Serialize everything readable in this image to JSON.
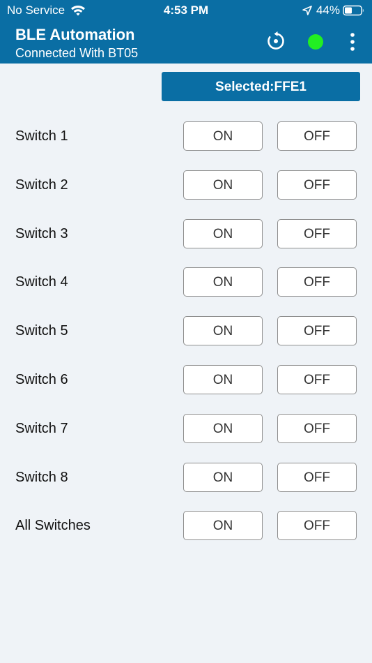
{
  "status_bar": {
    "carrier": "No Service",
    "time": "4:53 PM",
    "battery": "44%"
  },
  "app_bar": {
    "title": "BLE Automation",
    "subtitle": "Connected With BT05",
    "connection_color": "#22ee22",
    "icons": [
      "refresh-icon",
      "connection-status-dot",
      "more-vertical-icon"
    ]
  },
  "selected": {
    "label": "Selected:FFE1"
  },
  "colors": {
    "primary": "#0a6ea4",
    "background": "#eff3f7",
    "connected": "#22ee22"
  },
  "switches": [
    {
      "label": "Switch 1",
      "on": "ON",
      "off": "OFF"
    },
    {
      "label": "Switch 2",
      "on": "ON",
      "off": "OFF"
    },
    {
      "label": "Switch 3",
      "on": "ON",
      "off": "OFF"
    },
    {
      "label": "Switch 4",
      "on": "ON",
      "off": "OFF"
    },
    {
      "label": "Switch 5",
      "on": "ON",
      "off": "OFF"
    },
    {
      "label": "Switch 6",
      "on": "ON",
      "off": "OFF"
    },
    {
      "label": "Switch 7",
      "on": "ON",
      "off": "OFF"
    },
    {
      "label": "Switch 8",
      "on": "ON",
      "off": "OFF"
    },
    {
      "label": "All Switches",
      "on": "ON",
      "off": "OFF"
    }
  ]
}
